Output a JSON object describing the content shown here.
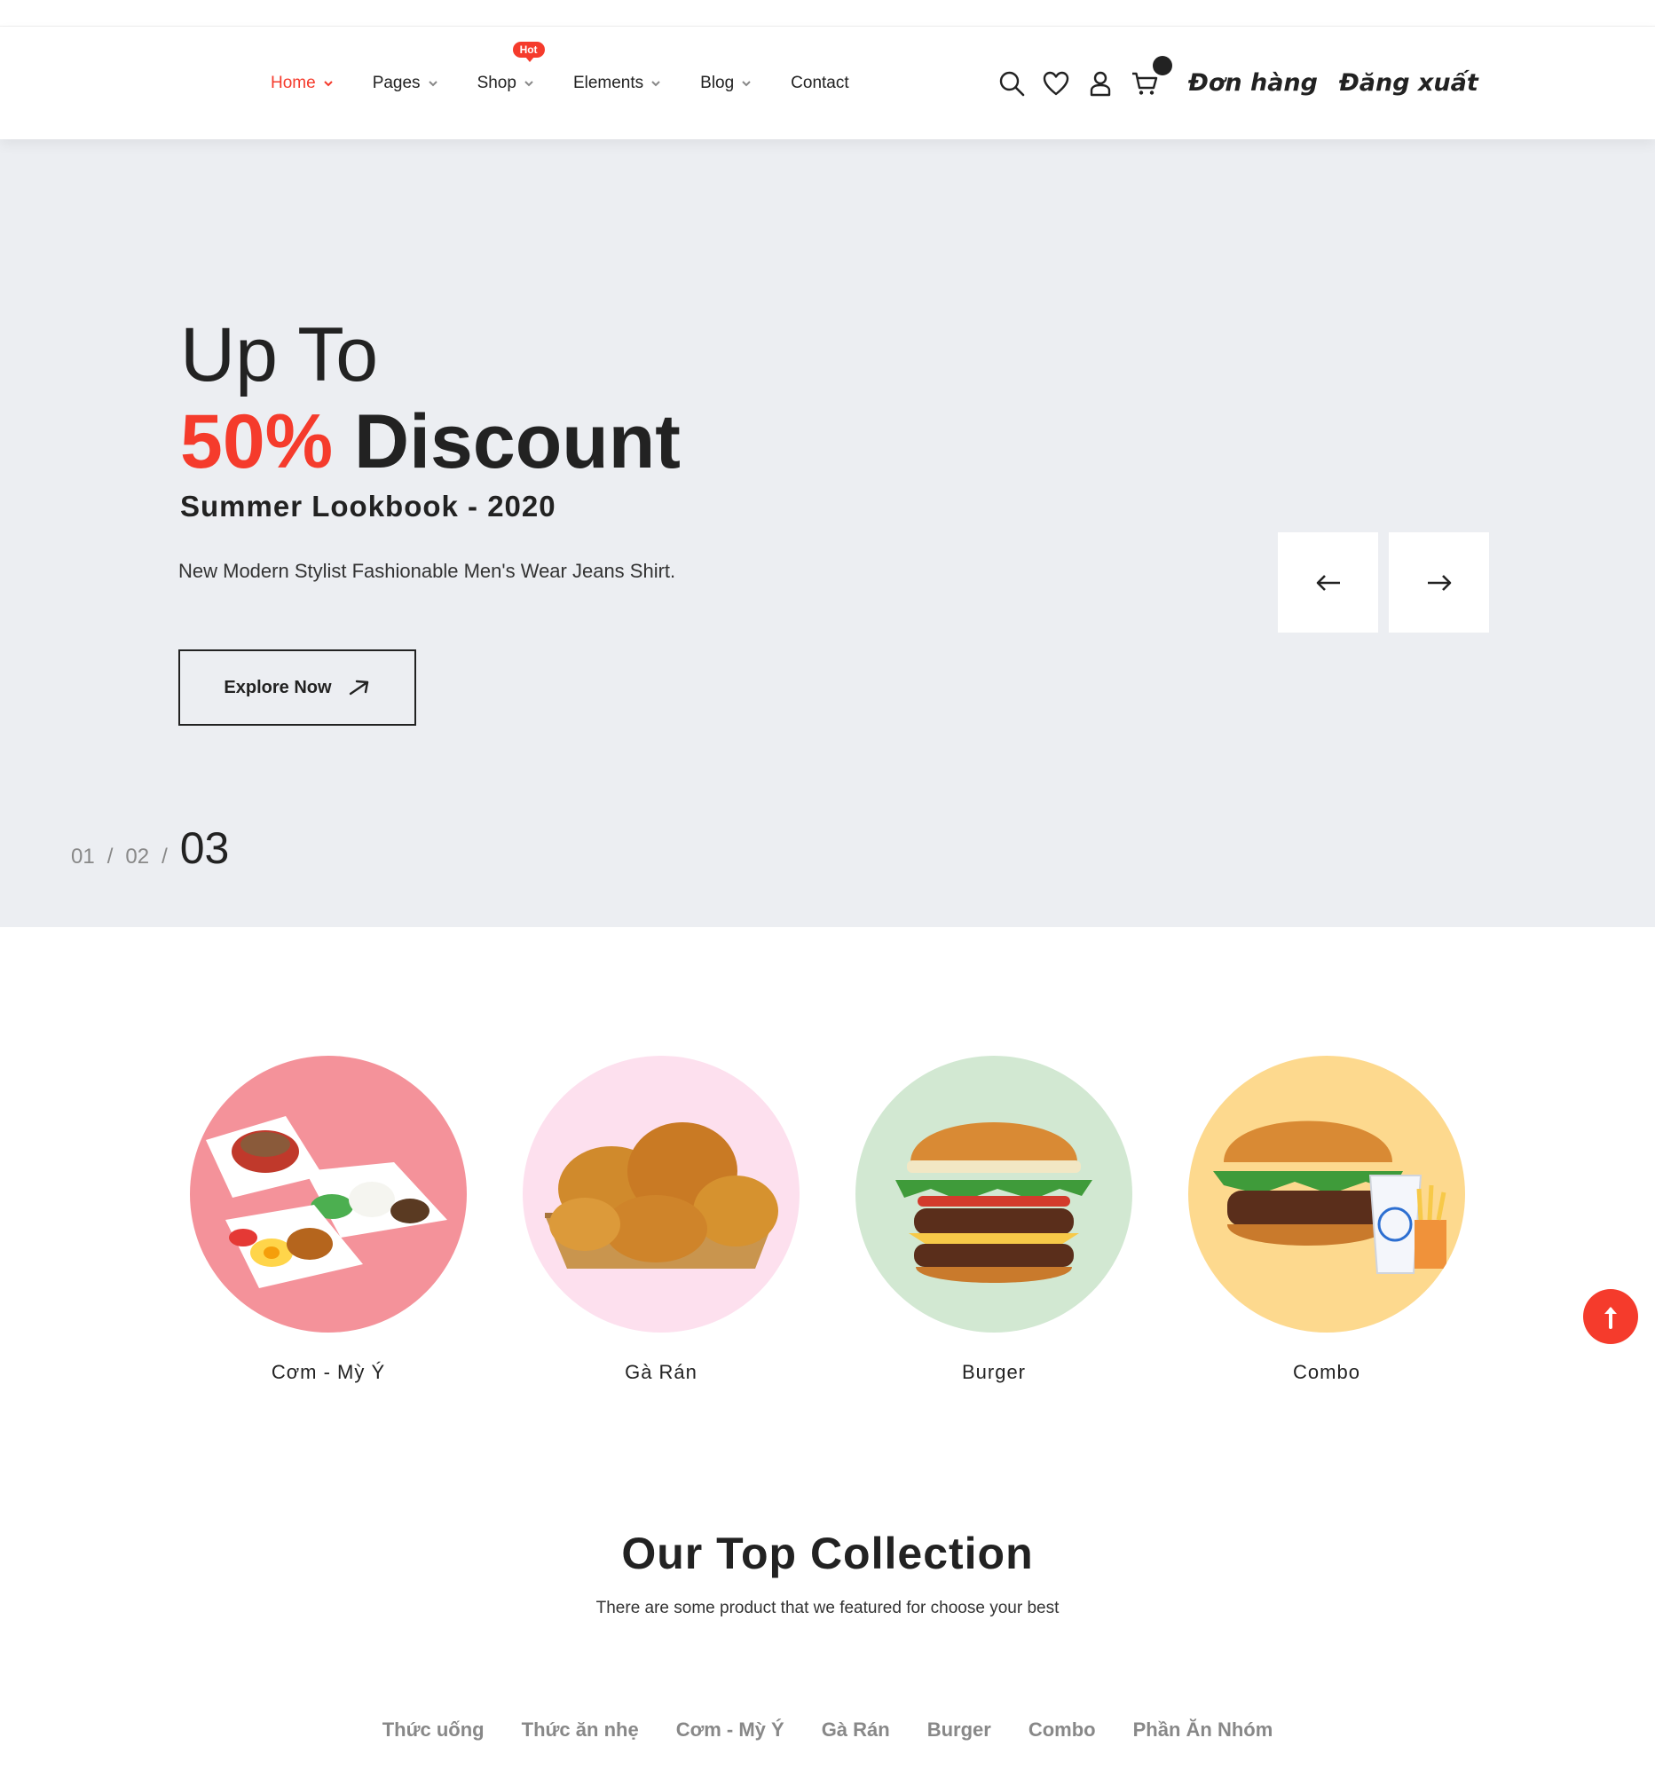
{
  "nav": {
    "items": [
      {
        "label": "Home",
        "active": true
      },
      {
        "label": "Pages"
      },
      {
        "label": "Shop",
        "badge": "Hot"
      },
      {
        "label": "Elements"
      },
      {
        "label": "Blog"
      },
      {
        "label": "Contact"
      }
    ]
  },
  "header_icons": [
    "search-icon",
    "heart-icon",
    "user-icon",
    "cart-icon"
  ],
  "user_links": {
    "orders": "Đơn hàng",
    "logout": "Đăng xuất"
  },
  "hero": {
    "title_line1": "Up To",
    "title_highlight": "50%",
    "title_rest": " Discount",
    "subtitle": "Summer Lookbook - 2020",
    "description": "New Modern Stylist Fashionable Men's Wear Jeans Shirt.",
    "button_label": "Explore Now",
    "pager": {
      "slide1": "01",
      "slide2": "02",
      "slide3": "03",
      "separator": "/"
    }
  },
  "categories": [
    {
      "label": "Cơm - Mỳ Ý",
      "bg": "#f4929a"
    },
    {
      "label": "Gà Rán",
      "bg": "#fde0ee"
    },
    {
      "label": "Burger",
      "bg": "#d2e8d2"
    },
    {
      "label": "Combo",
      "bg": "#fdd98e"
    }
  ],
  "collection": {
    "title": "Our Top Collection",
    "subtitle": "There are some product that we featured for choose your best",
    "tabs": [
      "Thức uống",
      "Thức ăn nhẹ",
      "Cơm - Mỳ Ý",
      "Gà Rán",
      "Burger",
      "Combo",
      "Phần Ăn Nhóm"
    ]
  },
  "colors": {
    "accent": "#f53b2c",
    "hero_bg": "#eceef2",
    "text": "#222222"
  }
}
